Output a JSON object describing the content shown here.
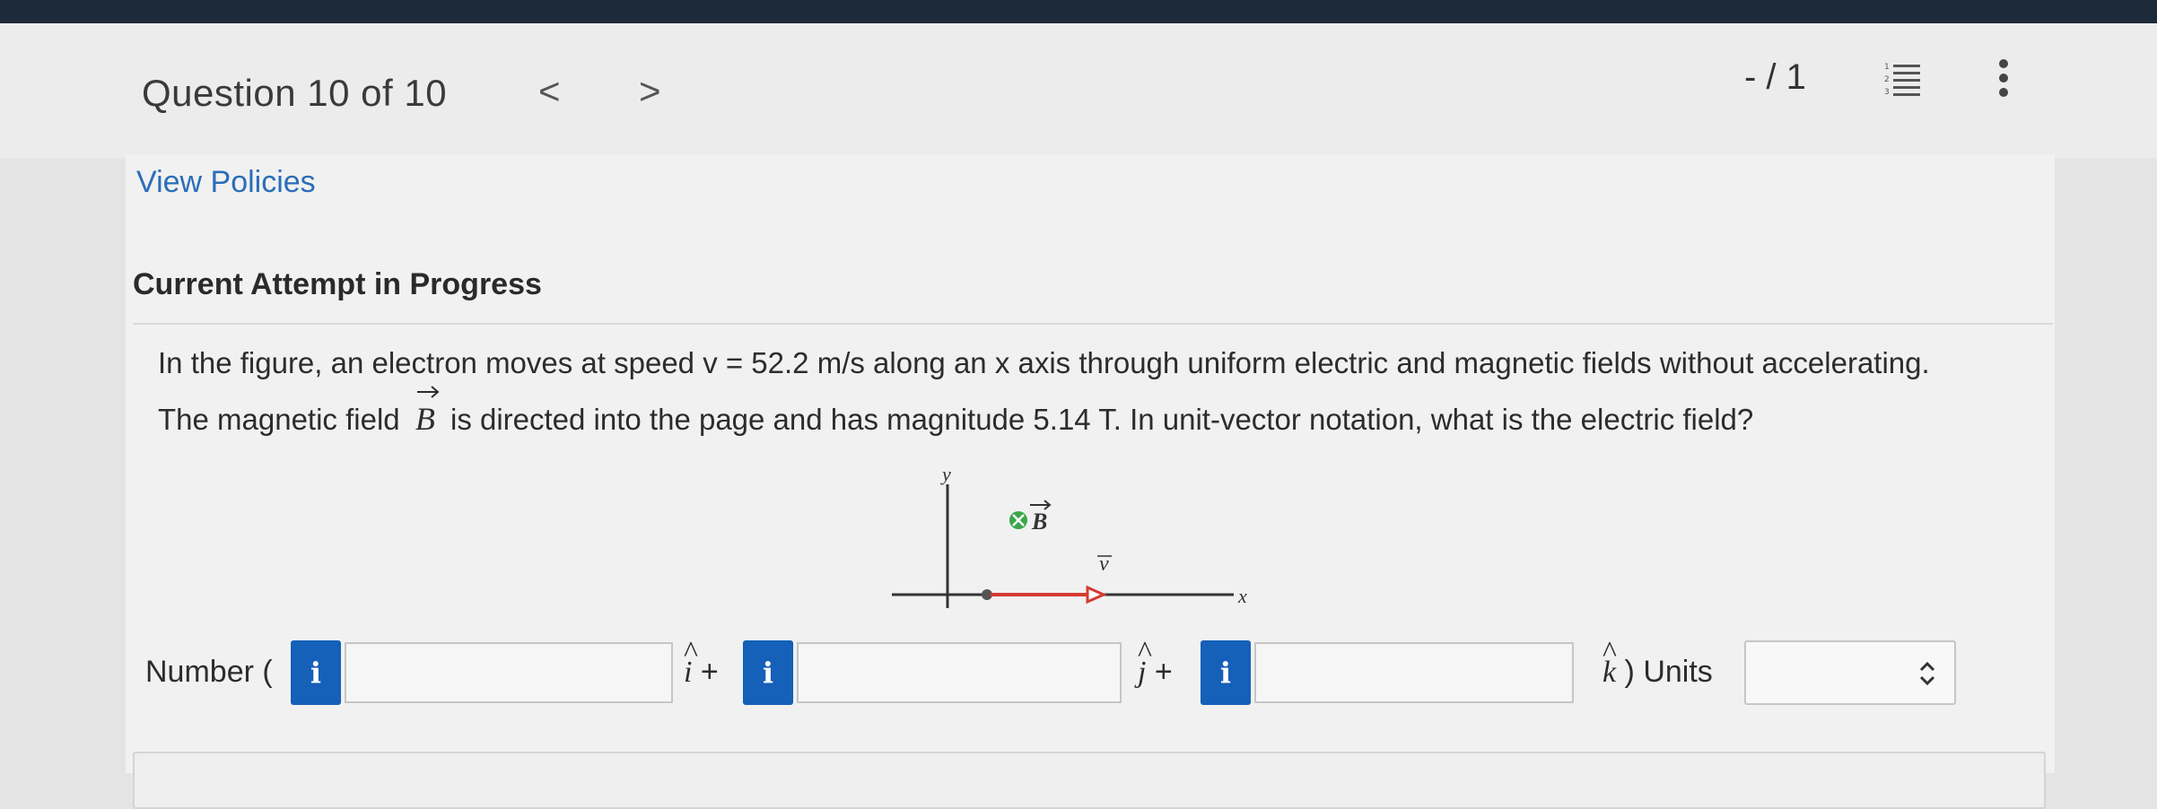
{
  "header": {
    "question_title": "Question 10 of 10",
    "prev_glyph": "<",
    "next_glyph": ">",
    "score": "- / 1"
  },
  "links": {
    "view_policies": "View Policies"
  },
  "attempt": {
    "status": "Current Attempt in Progress"
  },
  "question": {
    "line1": "In the figure, an electron moves at speed v = 52.2 m/s along an x axis through uniform electric and magnetic fields without accelerating.",
    "line2_a": "The magnetic field",
    "line2_var": "B",
    "line2_b": "is directed into the page and has magnitude 5.14 T. In unit-vector notation, what is the electric field?"
  },
  "figure": {
    "y_label": "y",
    "x_label": "x",
    "b_label": "B",
    "v_label": "v",
    "b_color": "#3aa64a",
    "v_color": "#d43a32"
  },
  "answer": {
    "number_label": "Number (",
    "i_unit": "i",
    "j_unit": "j",
    "k_unit": "k",
    "plus": "+",
    "close_units": ") Units",
    "info_glyph": "i",
    "i_value": "",
    "j_value": "",
    "k_value": "",
    "units_value": ""
  },
  "colors": {
    "link": "#2a6eb8",
    "info_button": "#1560b8",
    "topbar": "#1d2a3a"
  }
}
